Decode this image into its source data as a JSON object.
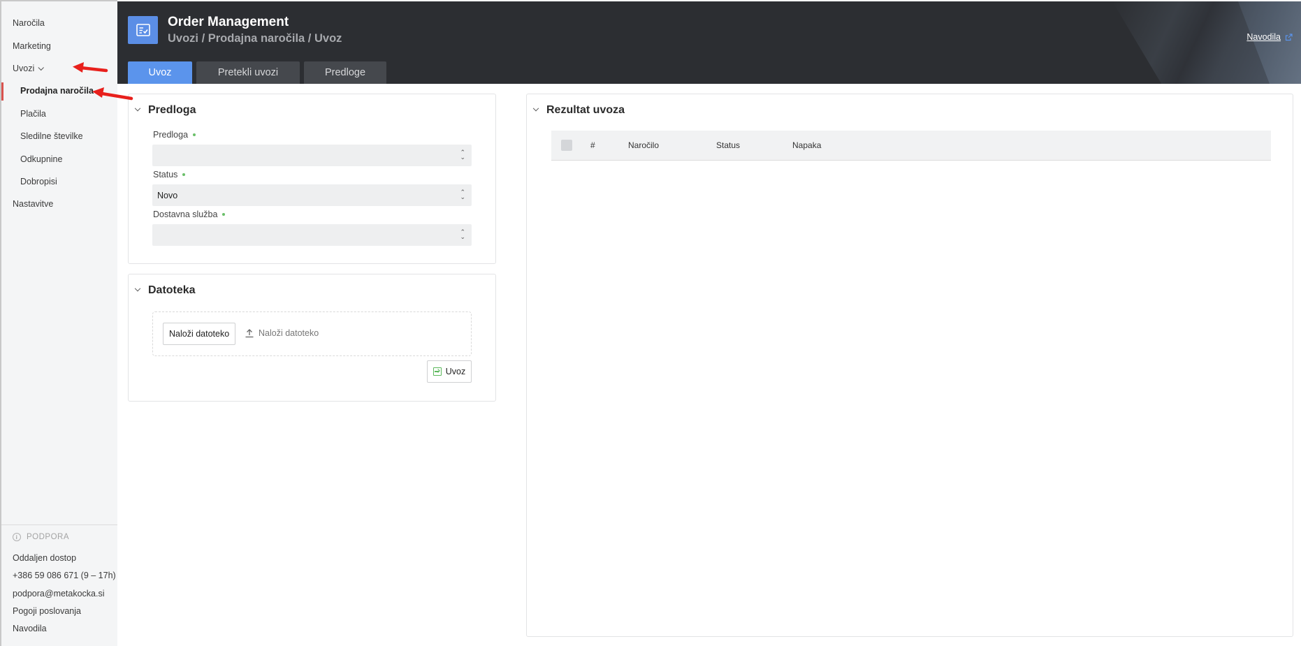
{
  "sidebar": {
    "items": [
      {
        "label": "Naročila"
      },
      {
        "label": "Marketing"
      },
      {
        "label": "Uvozi"
      },
      {
        "label": "Prodajna naročila"
      },
      {
        "label": "Plačila"
      },
      {
        "label": "Sledilne številke"
      },
      {
        "label": "Odkupnine"
      },
      {
        "label": "Dobropisi"
      },
      {
        "label": "Nastavitve"
      }
    ],
    "support": {
      "heading": "PODPORA",
      "items": [
        {
          "label": "Oddaljen dostop"
        },
        {
          "label": "+386 59 086 671 (9 – 17h)"
        },
        {
          "label": "podpora@metakocka.si"
        },
        {
          "label": "Pogoji poslovanja"
        },
        {
          "label": "Navodila"
        }
      ]
    }
  },
  "header": {
    "title": "Order Management",
    "breadcrumb": "Uvozi / Prodajna naročila / Uvoz",
    "help_link": "Navodila",
    "tabs": [
      {
        "label": "Uvoz"
      },
      {
        "label": "Pretekli uvozi"
      },
      {
        "label": "Predloge"
      }
    ]
  },
  "template_panel": {
    "title": "Predloga",
    "fields": [
      {
        "label": "Predloga",
        "value": ""
      },
      {
        "label": "Status",
        "value": "Novo"
      },
      {
        "label": "Dostavna služba",
        "value": ""
      }
    ]
  },
  "file_panel": {
    "title": "Datoteka",
    "upload_button": "Naloži datoteko",
    "upload_hint": "Naloži datoteko",
    "import_button": "Uvoz"
  },
  "result_panel": {
    "title": "Rezultat uvoza",
    "columns": [
      "#",
      "Naročilo",
      "Status",
      "Napaka"
    ]
  },
  "colors": {
    "accent": "#5b94ec",
    "header_bg": "#2c2e32",
    "required_dot": "#6abf69",
    "annotation_arrow": "#e8201c"
  }
}
